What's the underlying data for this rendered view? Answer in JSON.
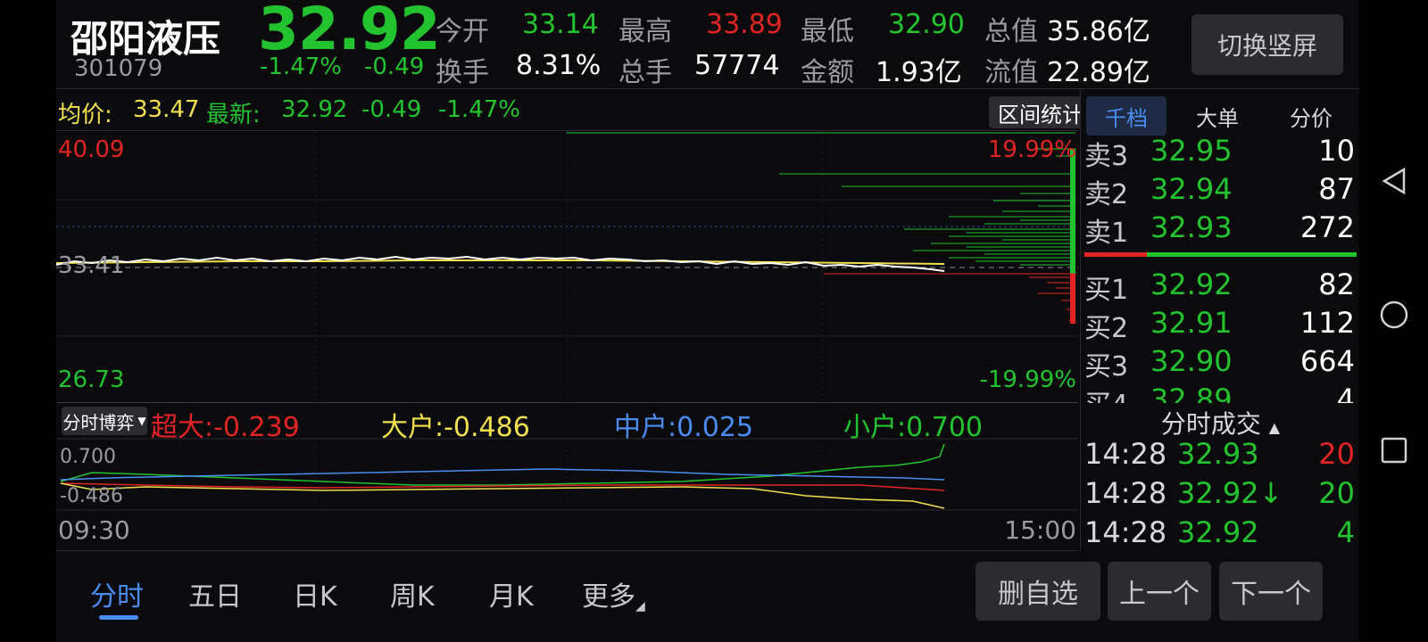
{
  "header": {
    "name": "邵阳液压",
    "code": "301079",
    "price": "32.92",
    "change_pct": "-1.47%",
    "change_val": "-0.49",
    "open_label": "今开",
    "open": "33.14",
    "high_label": "最高",
    "high": "33.89",
    "low_label": "最低",
    "low": "32.90",
    "mktcap_label": "总值",
    "mktcap": "35.86亿",
    "turnover_label": "换手",
    "turnover": "8.31%",
    "volume_label": "总手",
    "volume": "57774",
    "amount_label": "金额",
    "amount": "1.93亿",
    "float_label": "流值",
    "float": "22.89亿",
    "switch_btn": "切换竖屏"
  },
  "info_line": {
    "avg_label": "均价:",
    "avg": "33.47",
    "latest_label": "最新:",
    "latest": "32.92",
    "chg": "-0.49",
    "pct": "-1.47%",
    "range_btn": "区间统计"
  },
  "price_axis": {
    "top": "40.09",
    "mid": "33.41",
    "bottom": "26.73",
    "top_pct": "19.99%",
    "bottom_pct": "-19.99%"
  },
  "order_book": {
    "tabs": [
      "千档",
      "大单",
      "分价"
    ],
    "asks": [
      {
        "label": "卖3",
        "price": "32.95",
        "vol": "10"
      },
      {
        "label": "卖2",
        "price": "32.94",
        "vol": "87"
      },
      {
        "label": "卖1",
        "price": "32.93",
        "vol": "272"
      }
    ],
    "bids": [
      {
        "label": "买1",
        "price": "32.92",
        "vol": "82"
      },
      {
        "label": "买2",
        "price": "32.91",
        "vol": "112"
      },
      {
        "label": "买3",
        "price": "32.90",
        "vol": "664"
      },
      {
        "label": "买4",
        "price": "32.89",
        "vol": "4"
      }
    ]
  },
  "flow": {
    "selector": "分时博弈",
    "super_label": "超大:",
    "super": "-0.239",
    "large_label": "大户:",
    "large": "-0.486",
    "mid_label": "中户:",
    "mid": "0.025",
    "small_label": "小户:",
    "small": "0.700",
    "axis_top": "0.700",
    "axis_bottom": "-0.486",
    "time_start": "09:30",
    "time_end": "15:00"
  },
  "trades": {
    "title": "分时成交",
    "rows": [
      {
        "time": "14:28",
        "price": "32.93",
        "vol": "20",
        "vol_color": "#e02424"
      },
      {
        "time": "14:28",
        "price": "32.92↓",
        "vol": "20",
        "vol_color": "#22c32e"
      },
      {
        "time": "14:28",
        "price": "32.92",
        "vol": "4",
        "vol_color": "#22c32e"
      }
    ]
  },
  "bottom_tabs": [
    "分时",
    "五日",
    "日K",
    "周K",
    "月K",
    "更多"
  ],
  "bottom_buttons": [
    "删自选",
    "上一个",
    "下一个"
  ],
  "colors": {
    "up": "#e02424",
    "down": "#22c32e",
    "avg": "#f0e050",
    "accent": "#4a8cf0",
    "super": "#e02424",
    "large": "#f0e050",
    "mid": "#4a8cf0",
    "small": "#22c32e"
  },
  "icons": [
    "triangle-back-icon",
    "circle-home-icon",
    "square-recent-icon"
  ]
}
